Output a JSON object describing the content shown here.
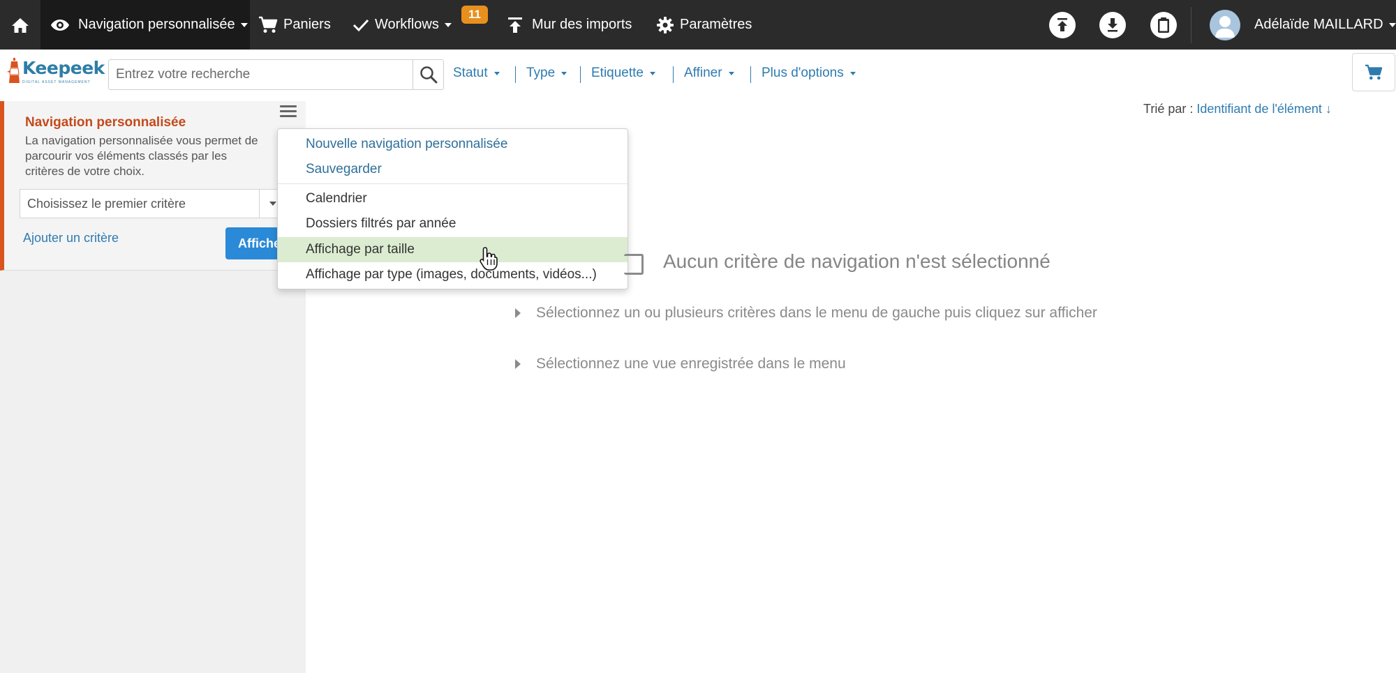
{
  "topbar": {
    "home_icon": "home-icon",
    "nav_label": "Navigation personnalisée",
    "nav_icon": "eye-icon",
    "paniers_label": "Paniers",
    "workflows_label": "Workflows",
    "workflows_badge": "11",
    "imports_label": "Mur des imports",
    "settings_label": "Paramètres",
    "user_name": "Adélaïde MAILLARD",
    "badge_color": "#e8901d"
  },
  "search": {
    "placeholder": "Entrez votre recherche",
    "value": ""
  },
  "filters": {
    "statut": "Statut",
    "type": "Type",
    "etiquette": "Etiquette",
    "affiner": "Affiner",
    "options": "Plus d'options"
  },
  "left": {
    "title": "Navigation personnalisée",
    "desc_line1": "La navigation personnalisée vous permet de",
    "desc_line2": "parcourir vos éléments classés par les",
    "desc_line3": "critères de votre choix.",
    "select_value": "Choisissez le premier critère",
    "add_label": "Ajouter un critère",
    "show_label": "Afficher"
  },
  "menu": {
    "new": "Nouvelle navigation personnalisée",
    "save": "Sauvegarder",
    "calendar": "Calendrier",
    "folders": "Dossiers filtrés par année",
    "by_size": "Affichage par taille",
    "by_type": "Affichage par type (images, documents, vidéos...)"
  },
  "main": {
    "sort_label": "Trié par :",
    "sort_value": "Identifiant de l'élément ↓",
    "empty_title": "Aucun critère de navigation n'est sélectionné",
    "hint1": "Sélectionnez un ou plusieurs critères dans le menu de gauche puis cliquez sur afficher",
    "hint2": "Sélectionnez une vue enregistrée dans le menu"
  },
  "colors": {
    "accent": "#d9541e",
    "link": "#2f7bb0",
    "primary_button": "#2a8ad7",
    "menu_hover": "#dcecd1"
  }
}
